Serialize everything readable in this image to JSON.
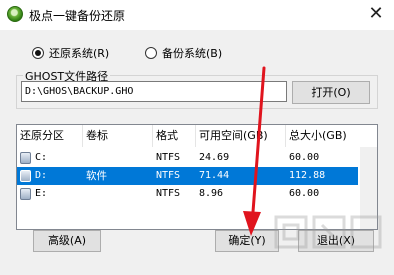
{
  "window": {
    "title": "极点一键备份还原",
    "close_glyph": "✕"
  },
  "mode": {
    "restore_label": "还原系统(R)",
    "backup_label": "备份系统(B)",
    "selected": "restore"
  },
  "path": {
    "label": "GHOST文件路径",
    "value": "D:\\GHOS\\BACKUP.GHO",
    "open_label": "打开(O)"
  },
  "table": {
    "headers": [
      "还原分区",
      "卷标",
      "格式",
      "可用空间(GB)",
      "总大小(GB)"
    ],
    "rows": [
      {
        "drive": "C:",
        "label": "",
        "format": "NTFS",
        "free": "24.69",
        "total": "60.00"
      },
      {
        "drive": "D:",
        "label": "软件",
        "format": "NTFS",
        "free": "71.44",
        "total": "112.88",
        "selected": true
      },
      {
        "drive": "E:",
        "label": "",
        "format": "NTFS",
        "free": "8.96",
        "total": "60.00"
      }
    ]
  },
  "buttons": {
    "advanced": "高级(A)",
    "ok": "确定(Y)",
    "exit": "退出(X)"
  },
  "colors": {
    "selection": "#0078d7",
    "arrow": "#e0141e"
  }
}
